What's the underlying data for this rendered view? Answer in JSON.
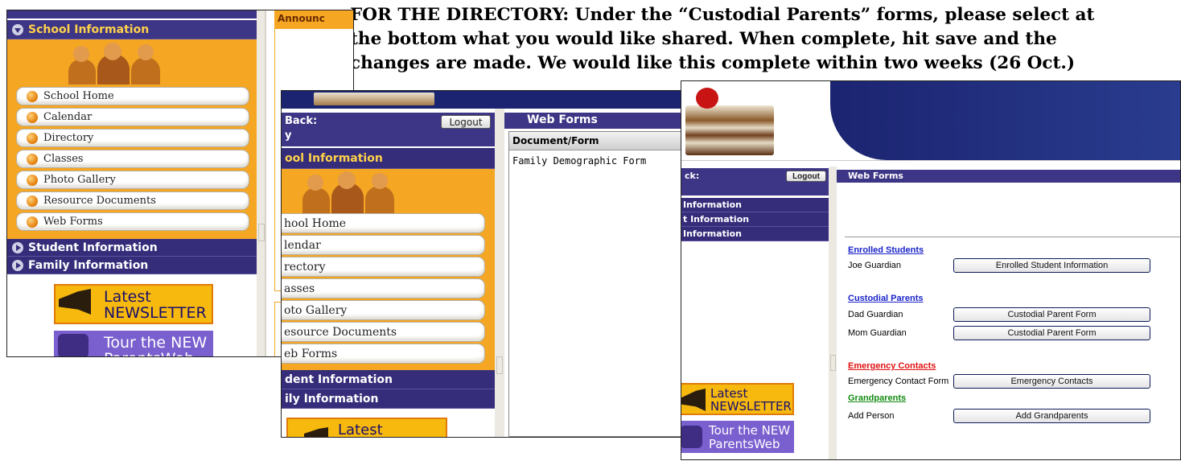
{
  "instruction": {
    "line1": "FOR THE DIRECTORY: Under the “Custodial Parents” forms, please select at",
    "line2": "the bottom what you would like shared.  When complete, hit save and the",
    "line3": "changes are made.  We would like this complete within two weeks (26 Oct.)"
  },
  "shot1": {
    "section_header": "School Information",
    "announcements_tab": "Announc",
    "nav_items": [
      "School Home",
      "Calendar",
      "Directory",
      "Classes",
      "Photo Gallery",
      "Resource Documents",
      "Web Forms"
    ],
    "sections": [
      "Student Information",
      "Family Information"
    ],
    "newsletter": {
      "line1": "Latest",
      "line2": "NEWSLETTER"
    },
    "tour": {
      "line1": "Tour the NEW",
      "line2": "ParentsWeb"
    }
  },
  "shot2": {
    "welcome_label": "Back:",
    "welcome_sub": "y",
    "logout_label": "Logout",
    "section_header": "ool Information",
    "nav_items": [
      "hool Home",
      "lendar",
      "rectory",
      "asses",
      "oto Gallery",
      "esource Documents",
      "eb Forms"
    ],
    "sections": [
      "dent Information",
      "ily Information"
    ],
    "newsletter_label": "Latest",
    "web_forms": {
      "title": "Web Forms",
      "column_header": "Document/Form",
      "rows": [
        "Family Demographic Form"
      ]
    }
  },
  "shot3": {
    "welcome_label": "ck:",
    "logout_label": "Logout",
    "sections": [
      "Information",
      "t Information",
      "Information"
    ],
    "newsletter": {
      "line1": "Latest",
      "line2": "NEWSLETTER"
    },
    "tour": {
      "line1": "Tour the NEW",
      "line2": "ParentsWeb"
    },
    "web_forms": {
      "title": "Web Forms",
      "groups": [
        {
          "heading": "Enrolled Students",
          "color": "#1a23c8",
          "rows": [
            {
              "label": "Joe Guardian",
              "button": "Enrolled Student Information"
            }
          ]
        },
        {
          "heading": "Custodial Parents",
          "color": "#1a23c8",
          "rows": [
            {
              "label": "Dad Guardian",
              "button": "Custodial Parent Form"
            },
            {
              "label": "Mom Guardian",
              "button": "Custodial Parent Form"
            }
          ]
        },
        {
          "heading": "Emergency Contacts",
          "color": "#e01010",
          "rows": [
            {
              "label": "Emergency Contact Form",
              "button": "Emergency Contacts"
            }
          ]
        },
        {
          "heading": "Grandparents",
          "color": "#128a12",
          "rows": [
            {
              "label": "Add Person",
              "button": "Add Grandparents"
            }
          ]
        }
      ]
    }
  },
  "colors": {
    "purple": "#3d3585",
    "orange": "#f5a623",
    "navy_banner": "#1b2470"
  }
}
